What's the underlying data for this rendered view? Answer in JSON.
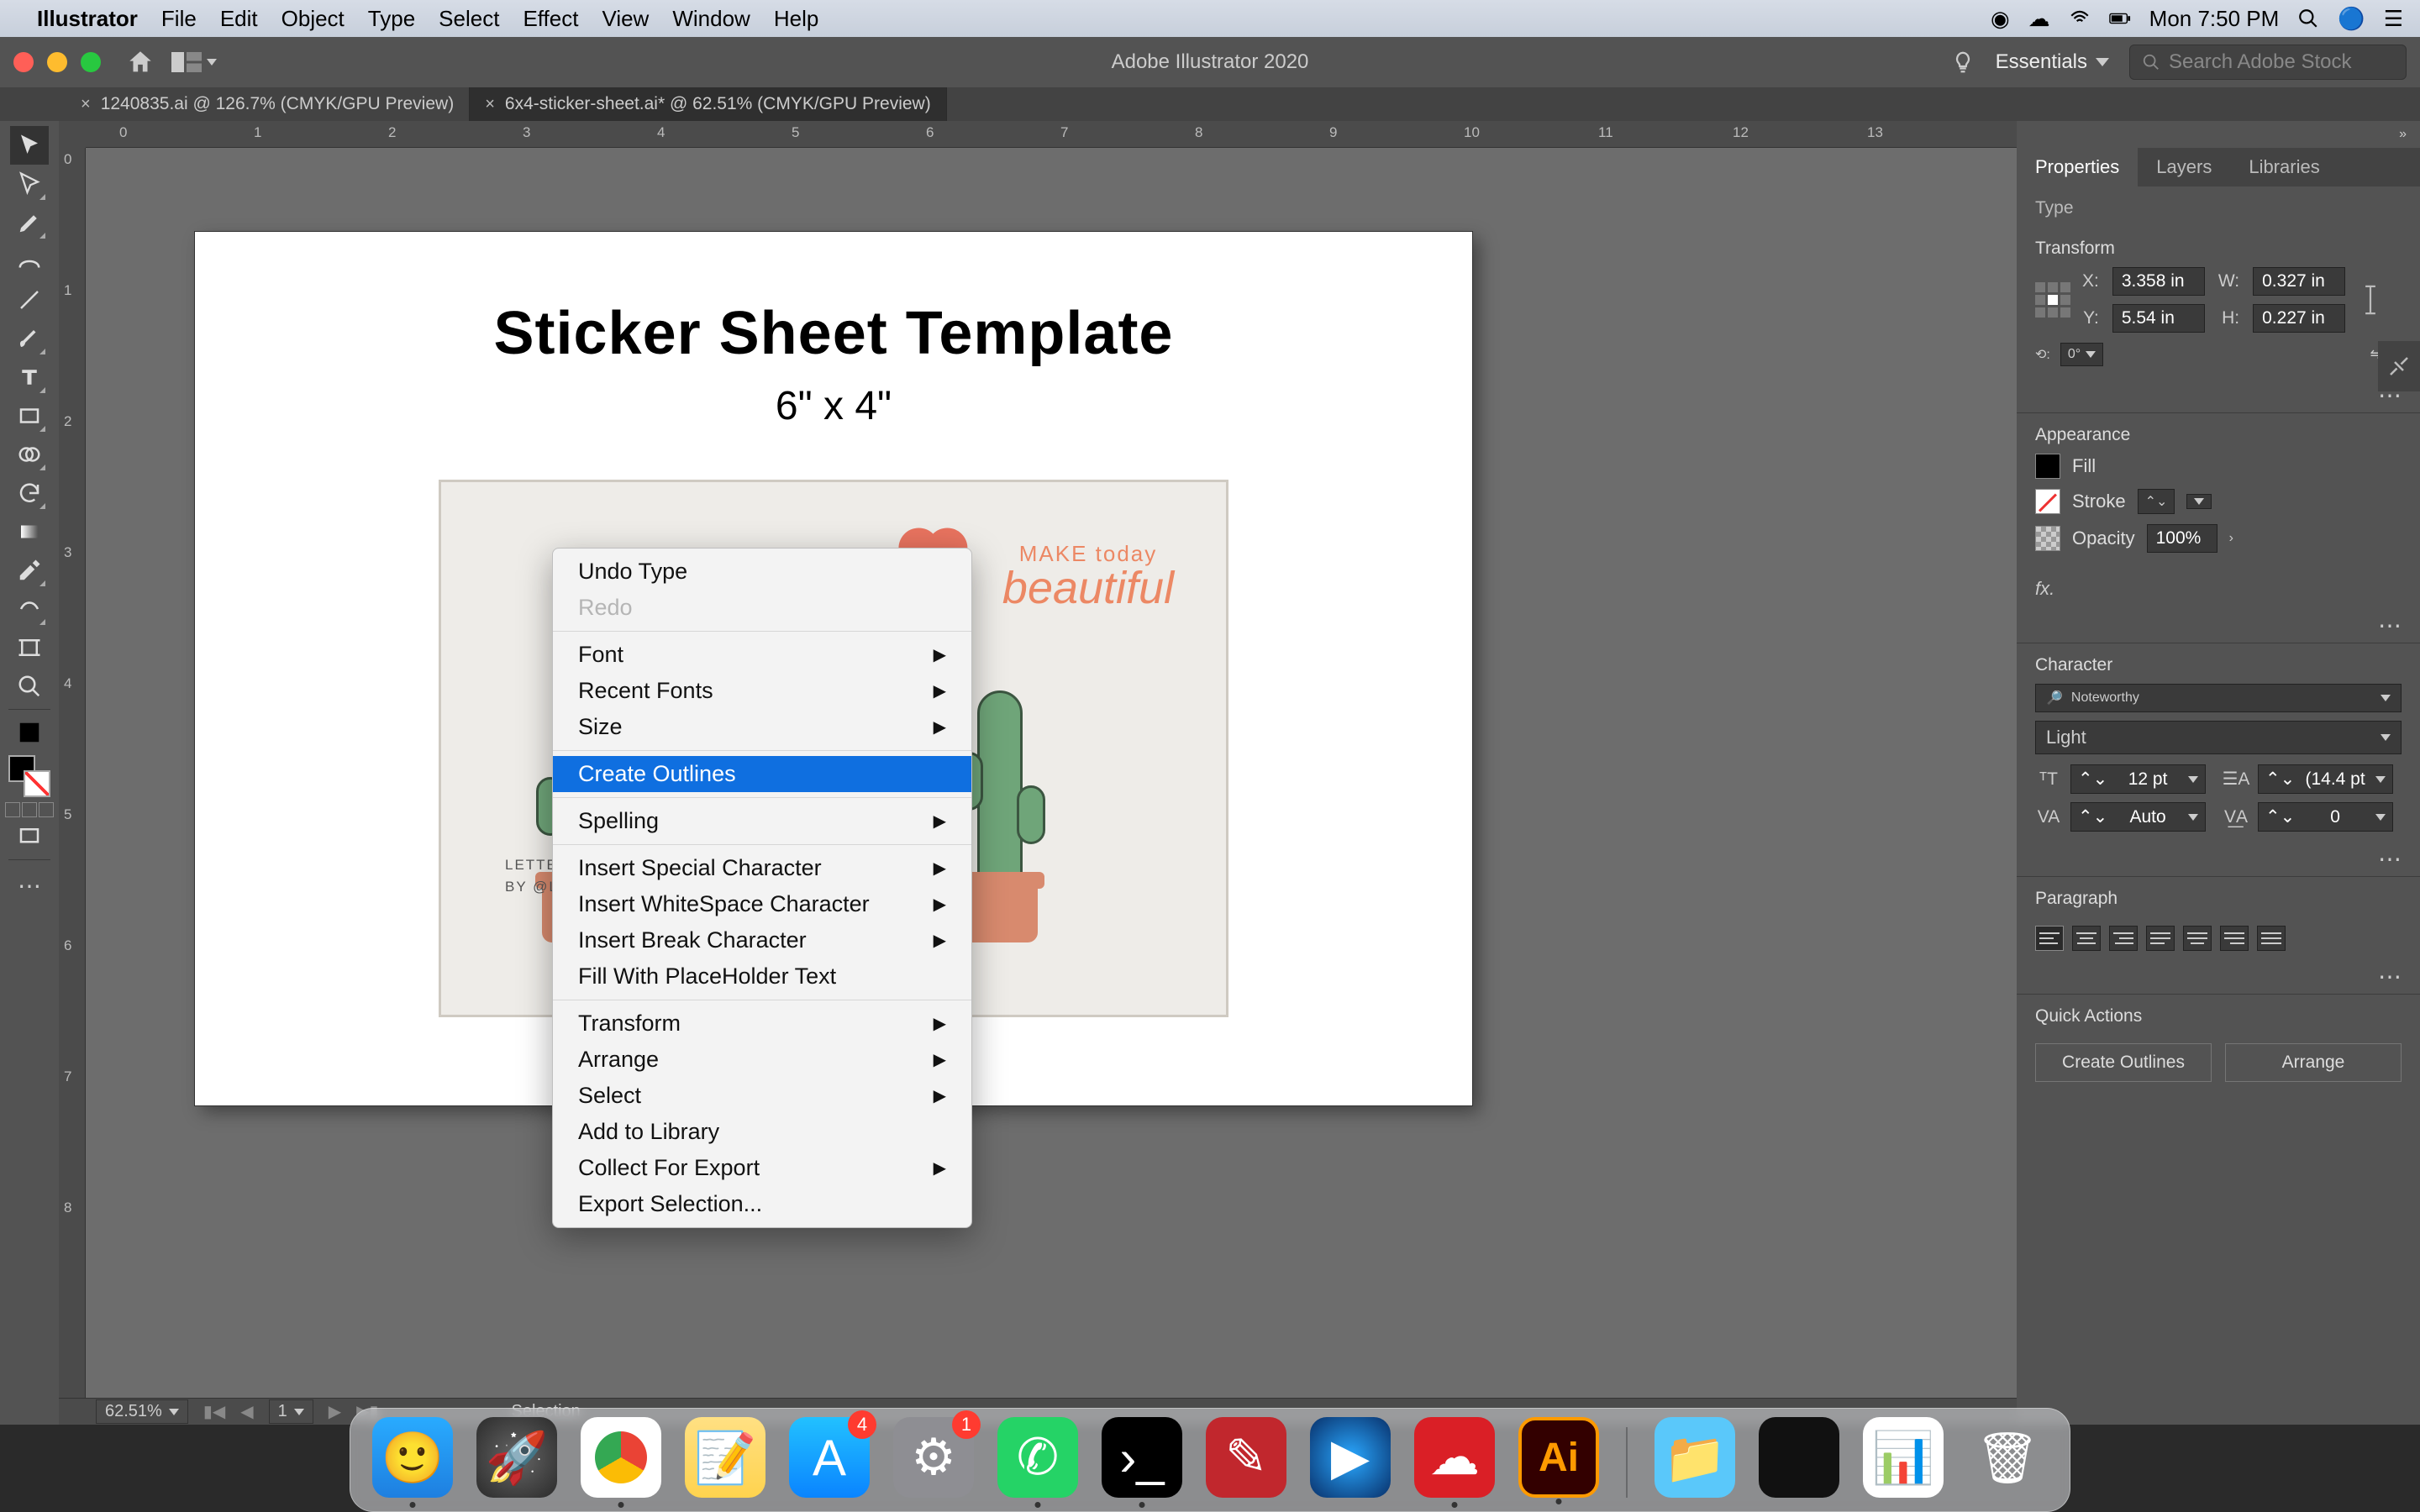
{
  "mac_menu": {
    "app": "Illustrator",
    "items": [
      "File",
      "Edit",
      "Object",
      "Type",
      "Select",
      "Effect",
      "View",
      "Window",
      "Help"
    ],
    "clock": "Mon 7:50 PM"
  },
  "ai_bar": {
    "title": "Adobe Illustrator 2020",
    "workspace": "Essentials",
    "search_placeholder": "Search Adobe Stock"
  },
  "tabs": [
    {
      "label": "1240835.ai @ 126.7% (CMYK/GPU Preview)",
      "active": false
    },
    {
      "label": "6x4-sticker-sheet.ai* @ 62.51% (CMYK/GPU Preview)",
      "active": true
    }
  ],
  "ruler_h": [
    "0",
    "1",
    "2",
    "3",
    "4",
    "5",
    "6",
    "7",
    "8",
    "9",
    "10",
    "11",
    "12",
    "13"
  ],
  "ruler_v": [
    "0",
    "1",
    "2",
    "3",
    "4",
    "5",
    "6",
    "7",
    "8"
  ],
  "artboard": {
    "title": "Sticker Sheet Template",
    "subtitle": "6\" x 4\"",
    "credit1": "LETTERING + ILL",
    "credit2": "BY @LETTERIN",
    "mb1": "MAKE today",
    "mb2": "beautiful"
  },
  "context_menu": [
    {
      "label": "Undo Type"
    },
    {
      "label": "Redo",
      "disabled": true
    },
    {
      "sep": true
    },
    {
      "label": "Font",
      "sub": true
    },
    {
      "label": "Recent Fonts",
      "sub": true
    },
    {
      "label": "Size",
      "sub": true
    },
    {
      "sep": true
    },
    {
      "label": "Create Outlines",
      "hl": true
    },
    {
      "sep": true
    },
    {
      "label": "Spelling",
      "sub": true
    },
    {
      "sep": true
    },
    {
      "label": "Insert Special Character",
      "sub": true
    },
    {
      "label": "Insert WhiteSpace Character",
      "sub": true
    },
    {
      "label": "Insert Break Character",
      "sub": true
    },
    {
      "label": "Fill With PlaceHolder Text"
    },
    {
      "sep": true
    },
    {
      "label": "Transform",
      "sub": true
    },
    {
      "label": "Arrange",
      "sub": true
    },
    {
      "label": "Select",
      "sub": true
    },
    {
      "label": "Add to Library"
    },
    {
      "label": "Collect For Export",
      "sub": true
    },
    {
      "label": "Export Selection..."
    }
  ],
  "status": {
    "zoom": "62.51%",
    "artboard_no": "1",
    "mode": "Selection"
  },
  "panels": {
    "tabs": [
      "Properties",
      "Layers",
      "Libraries"
    ],
    "type_label": "Type",
    "transform": {
      "label": "Transform",
      "x": "3.358 in",
      "y": "5.54 in",
      "w": "0.327 in",
      "h": "0.227 in",
      "angle": "0°"
    },
    "appearance": {
      "label": "Appearance",
      "fill": "Fill",
      "stroke": "Stroke",
      "opacity_label": "Opacity",
      "opacity": "100%"
    },
    "character": {
      "label": "Character",
      "font": "Noteworthy",
      "style": "Light",
      "size": "12 pt",
      "leading": "(14.4 pt",
      "kerning": "Auto",
      "tracking": "0"
    },
    "paragraph": {
      "label": "Paragraph"
    },
    "quick": {
      "label": "Quick Actions",
      "b1": "Create Outlines",
      "b2": "Arrange"
    }
  },
  "dock_badges": {
    "appstore": "4",
    "pref": "1"
  }
}
